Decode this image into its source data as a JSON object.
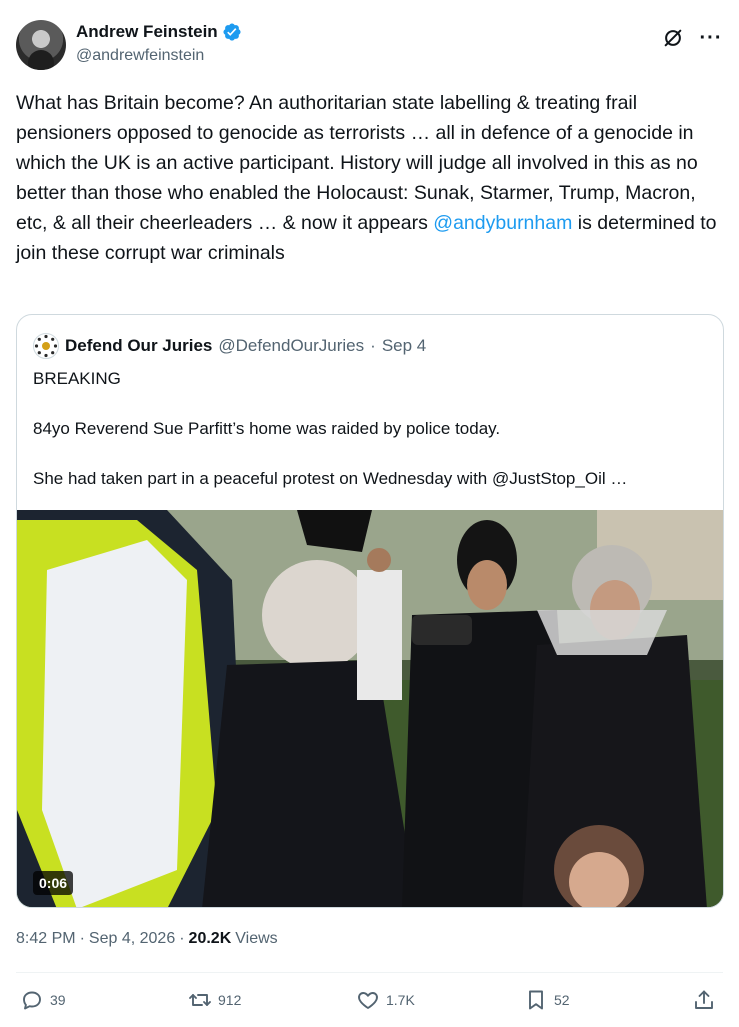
{
  "author": {
    "name": "Andrew Feinstein",
    "handle": "@andrewfeinstein"
  },
  "tweet": {
    "text_before": "What has Britain become? An authoritarian state labelling & treating frail pensioners opposed to genocide as terrorists … all in defence of a genocide in which the UK is an active participant. History will judge all involved in this as no better than those who enabled the Holocaust: Sunak, Starmer, Trump, Macron, etc, & all their cheerleaders … & now it appears ",
    "mention": "@andyburnham",
    "text_after": " is determined to join these corrupt war criminals"
  },
  "quote": {
    "name": "Defend Our Juries",
    "handle": "@DefendOurJuries",
    "separator": "·",
    "date": "Sep 4",
    "paragraphs": [
      "BREAKING",
      "84yo Reverend Sue Parfitt’s home was raided by police today.",
      "She had taken part in a peaceful protest on Wednesday with @JustStop_Oil …"
    ],
    "video_duration": "0:06"
  },
  "meta": {
    "time": "8:42 PM",
    "separator": "·",
    "date": "Sep 4, 2026",
    "separator2": "·",
    "views_count": "20.2K",
    "views_label": "Views"
  },
  "actions": {
    "replies": "39",
    "reposts": "912",
    "likes": "1.7K",
    "bookmarks": "52"
  },
  "icons": {
    "verified": "verified-badge-icon",
    "grok": "grok-icon",
    "more": "more-icon",
    "reply": "reply-icon",
    "repost": "repost-icon",
    "like": "heart-icon",
    "bookmark": "bookmark-icon",
    "share": "share-icon"
  },
  "colors": {
    "accent": "#1d9bf0",
    "text": "#0f1419",
    "muted": "#536471",
    "border": "#cfd9de"
  }
}
